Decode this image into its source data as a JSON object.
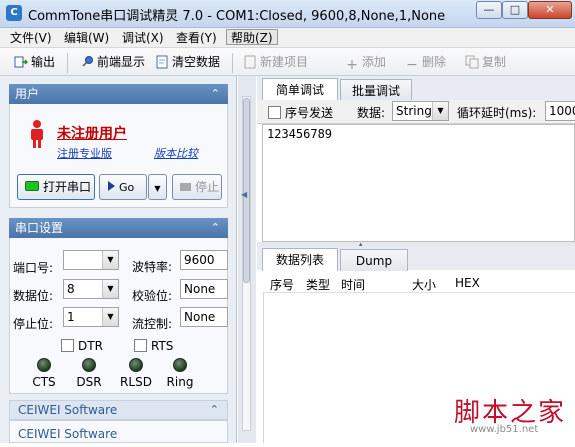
{
  "titlebar": {
    "title": "CommTone串口调试精灵 7.0 - COM1:Closed, 9600,8,None,1,None",
    "icon": "app-icon",
    "buttons": [
      "minimize",
      "maximize",
      "close"
    ]
  },
  "menu": {
    "items": [
      "文件(V)",
      "编辑(W)",
      "调试(X)",
      "查看(Y)",
      "帮助(Z)"
    ]
  },
  "toolbar": {
    "items": [
      {
        "label": "输出",
        "icon": "output-icon",
        "enabled": true
      },
      {
        "label": "前端显示",
        "icon": "pin-icon",
        "enabled": true
      },
      {
        "label": "清空数据",
        "icon": "clear-icon",
        "enabled": true
      },
      {
        "label": "新建项目",
        "icon": "new-doc-icon",
        "enabled": false
      },
      {
        "label": "添加",
        "icon": "plus-icon",
        "enabled": false
      },
      {
        "label": "删除",
        "icon": "minus-icon",
        "enabled": false
      },
      {
        "label": "复制",
        "icon": "copy-icon",
        "enabled": false
      }
    ]
  },
  "user_section": {
    "header": "用户",
    "username": "未注册用户",
    "register_link": "注册专业版",
    "compare_link": "版本比较",
    "open_port": "打开串口",
    "go": "Go",
    "stop": "停止"
  },
  "port_section": {
    "header": "串口设置",
    "port_label": "端口号:",
    "port_value": "",
    "baud_label": "波特率:",
    "baud_value": "9600",
    "databits_label": "数据位:",
    "databits_value": "8",
    "parity_label": "校验位:",
    "parity_value": "None",
    "stopbits_label": "停止位:",
    "stopbits_value": "1",
    "flow_label": "流控制:",
    "flow_value": "None",
    "dtr": "DTR",
    "rts": "RTS",
    "leds": [
      "CTS",
      "DSR",
      "RLSD",
      "Ring"
    ]
  },
  "software_sections": [
    "CEIWEI Software",
    "CEIWEI Software"
  ],
  "main": {
    "tabs": [
      "简单调试",
      "批量调试"
    ],
    "active_tab": 0,
    "seq_send": "序号发送",
    "data_label": "数据:",
    "data_type": "String",
    "loop_label": "循环延时(ms):",
    "loop_value": "1000",
    "send_text": "123456789"
  },
  "bottom": {
    "tabs": [
      "数据列表",
      "Dump"
    ],
    "columns": [
      "序号",
      "类型",
      "时间",
      "大小",
      "HEX"
    ]
  },
  "watermark": {
    "text": "脚本之家",
    "url": "www.jb51.net"
  },
  "colors": {
    "section_header": "#5a84b8",
    "user_name": "#c00000",
    "led_green": "#1fc21f"
  }
}
